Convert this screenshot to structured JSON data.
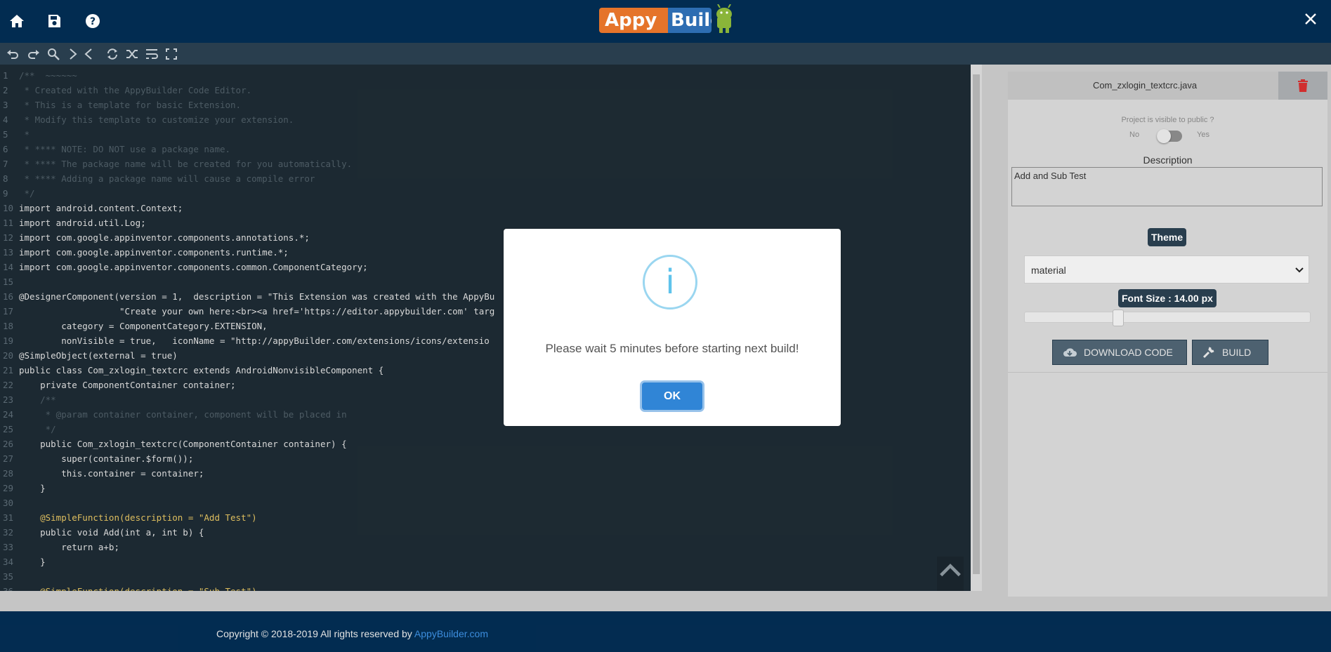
{
  "app": {
    "logo": {
      "part1": "Appy",
      "part2": "Builder"
    },
    "top_icons": [
      "home-icon",
      "save-icon",
      "help-icon"
    ],
    "close_icon": "close-icon"
  },
  "toolbar": {
    "icons": [
      "undo-icon",
      "redo-icon",
      "search-icon",
      "find-next-icon",
      "find-prev-icon",
      "replace-icon",
      "replace-all-icon",
      "wrap-icon",
      "fullscreen-icon"
    ]
  },
  "editor": {
    "lines": [
      "/**  ~~~~~~",
      " * Created with the AppyBuilder Code Editor.",
      " * This is a template for basic Extension.",
      " * Modify this template to customize your extension.",
      " *",
      " * **** NOTE: DO NOT use a package name.",
      " * **** The package name will be created for you automatically.",
      " * **** Adding a package name will cause a compile error",
      " */",
      "import android.content.Context;",
      "import android.util.Log;",
      "import com.google.appinventor.components.annotations.*;",
      "import com.google.appinventor.components.runtime.*;",
      "import com.google.appinventor.components.common.ComponentCategory;",
      "",
      "@DesignerComponent(version = 1,  description = \"This Extension was created with the AppyBu",
      "                   \"Create your own here:<br><a href='https://editor.appybuilder.com' targ",
      "        category = ComponentCategory.EXTENSION,",
      "        nonVisible = true,   iconName = \"http://appyBuilder.com/extensions/icons/extensio",
      "@SimpleObject(external = true)",
      "public class Com_zxlogin_textcrc extends AndroidNonvisibleComponent {",
      "    private ComponentContainer container;",
      "    /**",
      "     * @param container container, component will be placed in",
      "     */",
      "    public Com_zxlogin_textcrc(ComponentContainer container) {",
      "        super(container.$form());",
      "        this.container = container;",
      "    }",
      "",
      "    @SimpleFunction(description = \"Add Test\")",
      "    public void Add(int a, int b) {",
      "        return a+b;",
      "    }",
      "",
      "    @SimpleFunction(description = \"Sub Test\")"
    ],
    "line_numbers": [
      "1",
      "2",
      "3",
      "4",
      "5",
      "6",
      "7",
      "8",
      "9",
      "10",
      "11",
      "12",
      "13",
      "14",
      "15",
      "16",
      "17",
      "18",
      "19",
      "20",
      "21",
      "22",
      "23",
      "24",
      "25",
      "26",
      "27",
      "28",
      "29",
      "30",
      "31",
      "32",
      "33",
      "34",
      "35",
      "36"
    ]
  },
  "panel": {
    "file_name": "Com_zxlogin_textcrc.java",
    "visibility_question": "Project is visible to public ?",
    "no_label": "No",
    "yes_label": "Yes",
    "visible": false,
    "description_label": "Description",
    "description_value": "Add and Sub Test",
    "theme_label": "Theme",
    "theme_value": "material",
    "font_size_label": "Font Size : 14.00 px",
    "download_label": "DOWNLOAD CODE",
    "build_label": "BUILD"
  },
  "dialog": {
    "icon": "info-icon",
    "icon_text": "i",
    "message": "Please wait 5 minutes before starting next build!",
    "ok_label": "OK"
  },
  "footer": {
    "copyright": "Copyright © 2018-2019 All rights reserved by ",
    "link_text": "AppyBuilder.com"
  }
}
